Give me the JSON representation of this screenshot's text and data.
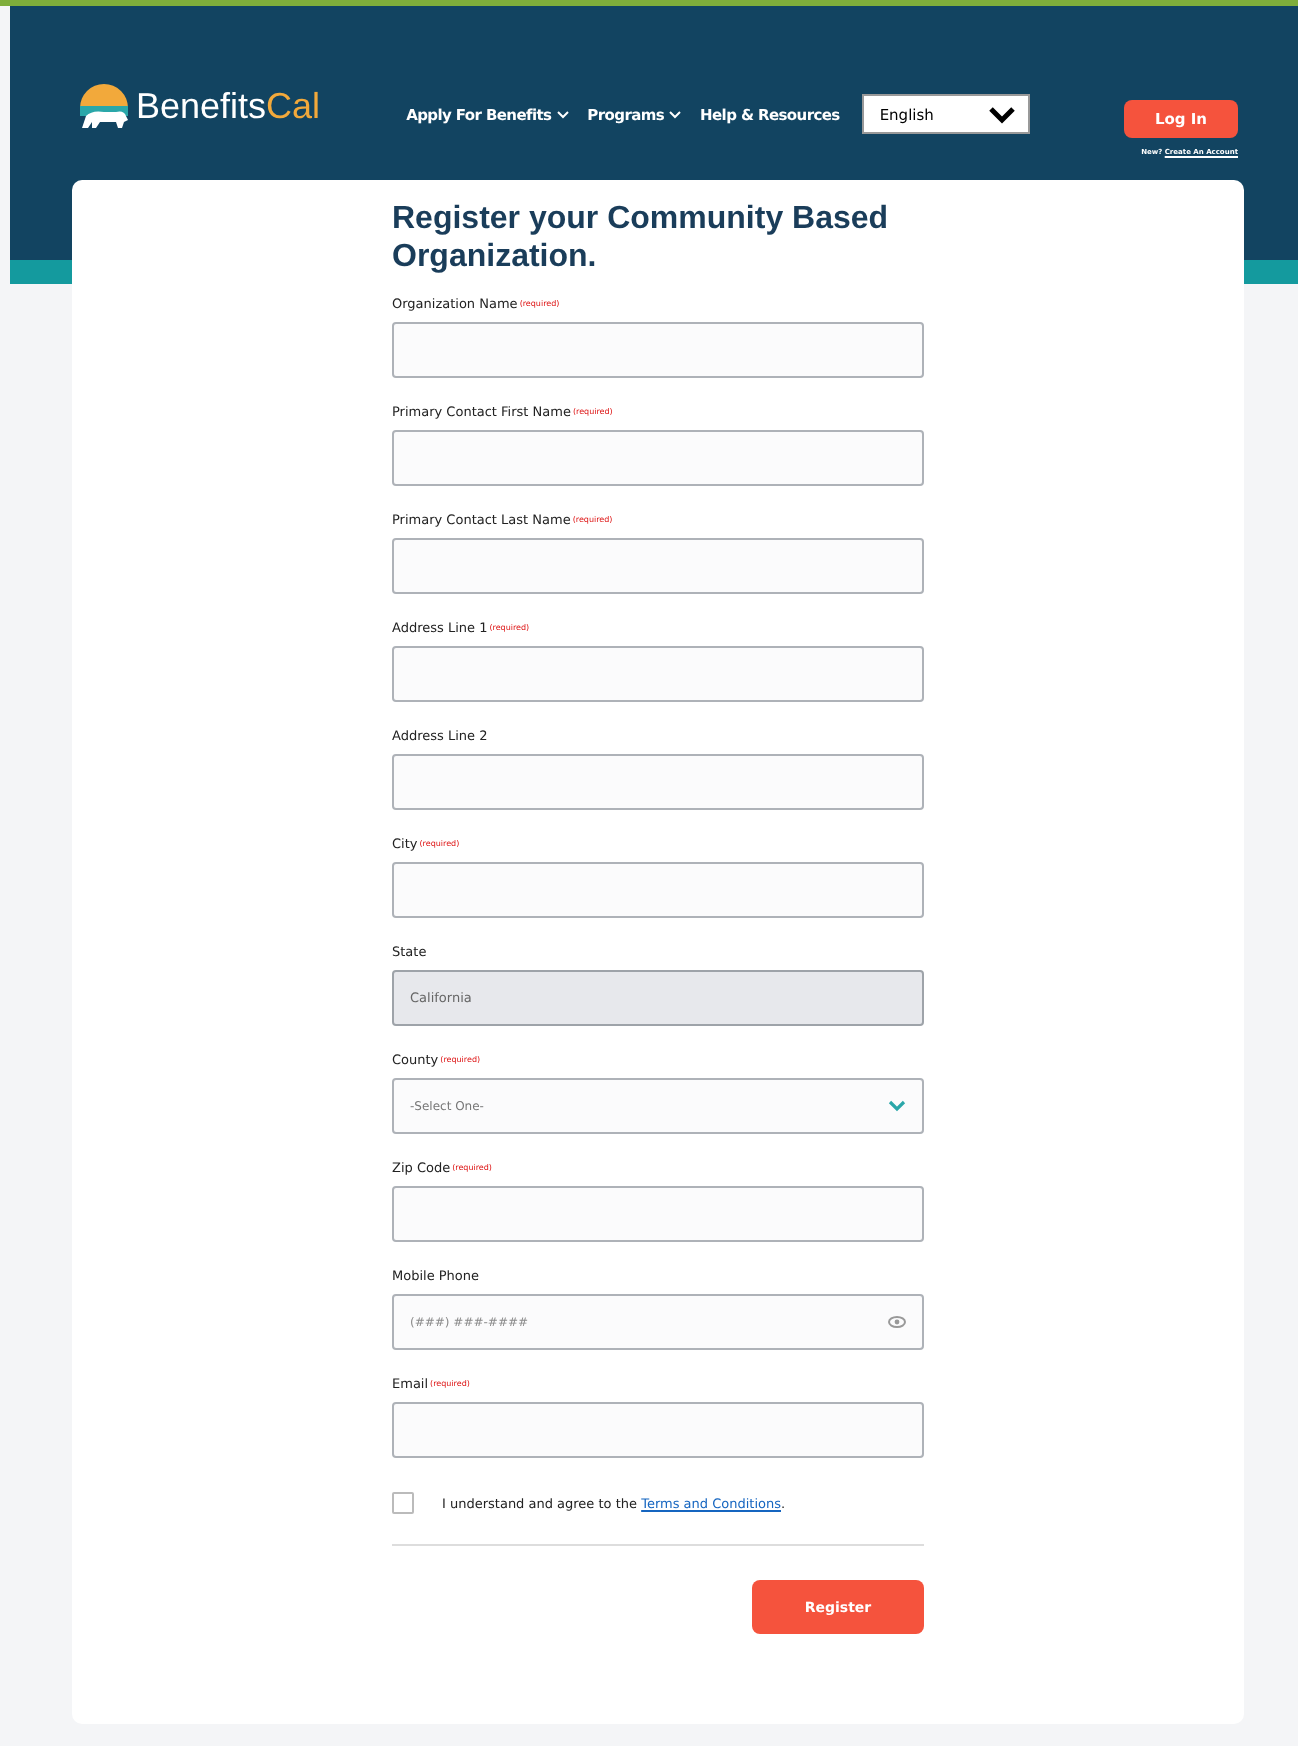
{
  "header": {
    "logo_text": {
      "first": "Benefits",
      "second": "Cal"
    },
    "nav": [
      {
        "label": "Apply For Benefits",
        "has_menu": true
      },
      {
        "label": "Programs",
        "has_menu": true
      },
      {
        "label": "Help & Resources",
        "has_menu": false
      }
    ],
    "language": {
      "value": "English"
    },
    "login_button": "Log In",
    "account_prompt": "New?",
    "account_link": "Create An Account"
  },
  "form": {
    "title": "Register your Community Based Organization.",
    "fields": [
      {
        "label": "Organization Name",
        "note": "(required)",
        "kind": "text"
      },
      {
        "label": "Primary Contact First Name",
        "note": "(required)",
        "kind": "text"
      },
      {
        "label": "Primary Contact Last Name",
        "note": "(required)",
        "kind": "text"
      },
      {
        "label": "Address Line 1",
        "note": "(required)",
        "kind": "text"
      },
      {
        "label": "Address Line 2",
        "kind": "text"
      },
      {
        "label": "City",
        "note": "(required)",
        "kind": "text"
      },
      {
        "label": "State",
        "kind": "disabled",
        "value": "California"
      },
      {
        "label": "County",
        "note": "(required)",
        "kind": "select",
        "placeholder": "-Select One-"
      },
      {
        "label": "Zip Code",
        "note": "(required)",
        "kind": "text"
      },
      {
        "label": "Mobile Phone",
        "kind": "phone",
        "placeholder": "(###) ###-####"
      },
      {
        "label": "Email",
        "note": "(required)",
        "kind": "text"
      }
    ],
    "terms": {
      "checked": false,
      "text": "I understand and agree to the",
      "link": "Terms and Conditions",
      "end": "."
    },
    "submit": "Register"
  }
}
